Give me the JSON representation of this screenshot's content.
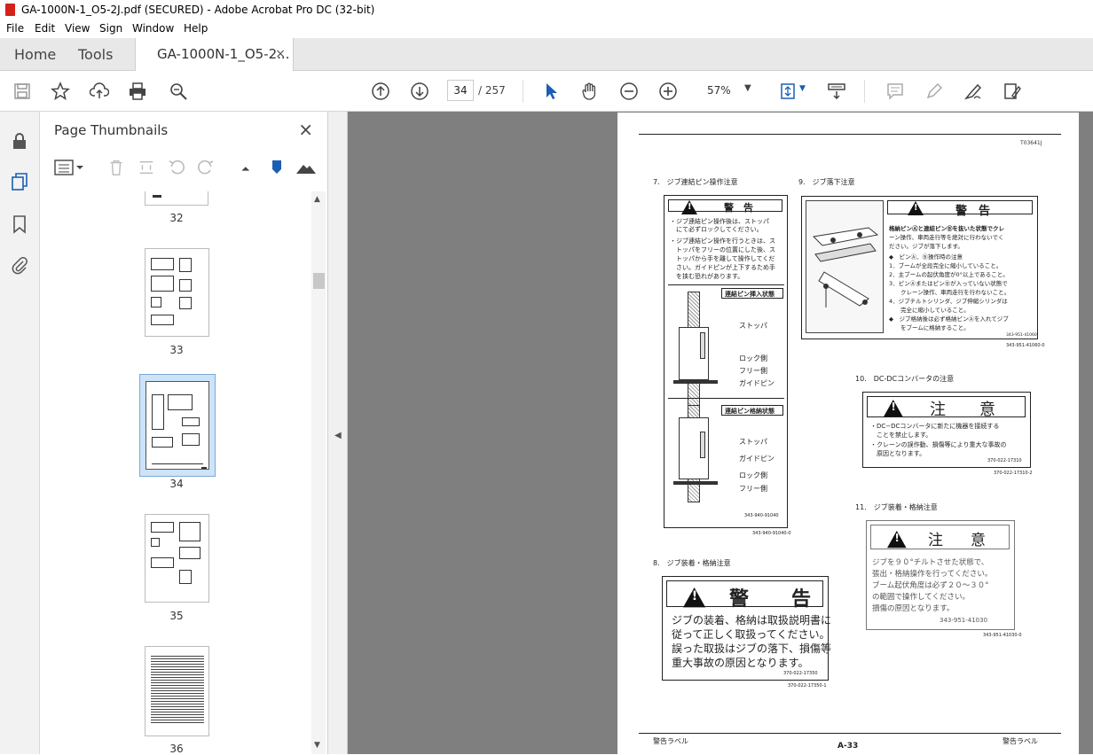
{
  "window": {
    "title": "GA-1000N-1_O5-2J.pdf (SECURED) - Adobe Acrobat Pro DC (32-bit)"
  },
  "menu": [
    "File",
    "Edit",
    "View",
    "Sign",
    "Window",
    "Help"
  ],
  "tabs": {
    "home": "Home",
    "tools": "Tools",
    "document": "GA-1000N-1_O5-2...",
    "close": "×"
  },
  "toolbar": {
    "page_current": "34",
    "page_total": "/ 257",
    "zoom": "57%"
  },
  "panel": {
    "title": "Page Thumbnails",
    "close": "×",
    "thumbnails": [
      {
        "label": "32"
      },
      {
        "label": "33"
      },
      {
        "label": "34"
      },
      {
        "label": "35"
      },
      {
        "label": "36"
      }
    ]
  },
  "pdfpage": {
    "doc_code": "T03641J",
    "sec7_title": "7.　ジブ連結ピン操作注意",
    "sec7_head": "警　告",
    "sec7_text1": "・ジブ連結ピン操作後は、ストッパ",
    "sec7_text2": "　にて必ずロックしてください。",
    "sec7_text3": "・ジブ連結ピン操作を行うときは、ス",
    "sec7_text4": "　トッパをフリーの位置にした後、ス",
    "sec7_text5": "　トッパから手を離して操作してくだ",
    "sec7_text6": "　さい。ガイドピンが上下するため手",
    "sec7_text7": "　を挟む恐れがあります。",
    "sec7_diag1_title": "連結ピン挿入状態",
    "sec7_diag2_title": "連結ピン格納状態",
    "lbl_stopper": "ストッパ",
    "lbl_lock": "ロック側",
    "lbl_free": "フリー側",
    "lbl_guide": "ガイドピン",
    "sec7_code": "343-940-91040",
    "sec7_code2": "343-940-91040-0",
    "sec8_title": "8.　ジブ装着・格納注意",
    "sec8_head_a": "警",
    "sec8_head_b": "告",
    "sec8_text1": "ジブの装着、格納は取扱説明書に",
    "sec8_text2": "従って正しく取扱ってください。",
    "sec8_text3": "誤った取扱はジブの落下、損傷等",
    "sec8_text4": "重大事故の原因となります。",
    "sec8_code": "370-022-17350",
    "sec8_code2": "370-022-17350-1",
    "sec9_title": "9.　ジブ落下注意",
    "sec9_head": "警　告",
    "sec9_text1": "格納ピンⒶと連結ピンⒷを抜いた状態でクレ",
    "sec9_text2": "ーン操作、車両走行等を絶対に行わないでく",
    "sec9_text3": "ださい。ジブが落下します。",
    "sec9_text4": "◆　ピンⒶ、Ⓑ操作時の注意",
    "sec9_text5": "1．ブームが全段完全に縮小していること。",
    "sec9_text6": "2．主ブームの起伏角度が0°以上であること。",
    "sec9_text7": "3．ピンⒶまたはピンⒷが入っていない状態で",
    "sec9_text8": "　　クレーン操作、車両走行を行わないこと。",
    "sec9_text9": "4．ジブチルトシリンダ、ジブ伸縮シリンダは",
    "sec9_text10": "　　完全に縮小していること。",
    "sec9_text11": "◆　ジブ格納後は必ず格納ピンⒶを入れてジブ",
    "sec9_text12": "　　をブームに格納すること。",
    "sec9_code": "343-951-41060",
    "sec9_code2": "343-951-41060-0",
    "sec10_title": "10.　DC-DCコンバータの注意",
    "sec10_head_a": "注",
    "sec10_head_b": "意",
    "sec10_text1": "・DC−DCコンバータに新たに機器を接続する",
    "sec10_text2": "　ことを禁止します。",
    "sec10_text3": "・クレーンの誤作動、損傷等により重大な事故の",
    "sec10_text4": "　原因となります。",
    "sec10_code": "370-022-17310",
    "sec10_code2": "370-022-17310-2",
    "sec11_title": "11.　ジブ装着・格納注意",
    "sec11_head_a": "注",
    "sec11_head_b": "意",
    "sec11_text1": "ジブを９０°チルトさせた状態で、",
    "sec11_text2": "張出・格納操作を行ってください。",
    "sec11_text3": "ブーム起伏角度は必ず２０〜３０°",
    "sec11_text4": "の範囲で操作してください。",
    "sec11_text5": "損傷の原因となります。",
    "sec11_code": "343-951-41030",
    "sec11_code2": "343-951-41030-0",
    "footer_left": "警告ラベル",
    "footer_center": "A-33",
    "footer_right": "警告ラベル"
  }
}
